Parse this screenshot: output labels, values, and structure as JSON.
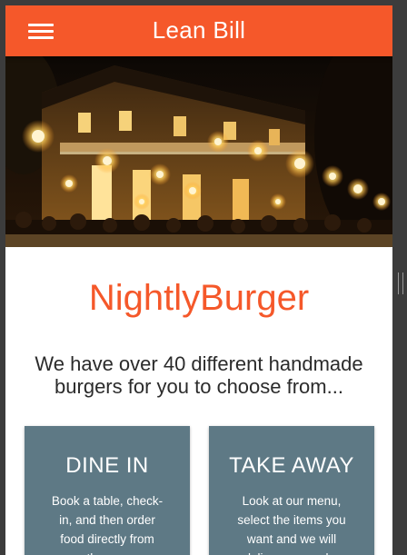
{
  "app_bar": {
    "title": "Lean Bill",
    "menu_icon": "hamburger-menu-icon",
    "color": "#f5582a"
  },
  "hero": {
    "image": "restaurant-exterior-at-night-with-lanterns"
  },
  "restaurant": {
    "name": "NightlyBurger",
    "tagline": "We have over 40 different handmade burgers for you to choose from...",
    "brand_color": "#f5582a"
  },
  "cards": {
    "color": "#5e7985",
    "dine_in": {
      "title": "DINE IN",
      "description": "Book a table, check-in, and then order food directly from the app"
    },
    "take_away": {
      "title": "TAKE AWAY",
      "description": "Look at our menu, select the items you want and we will deliver your order"
    }
  }
}
